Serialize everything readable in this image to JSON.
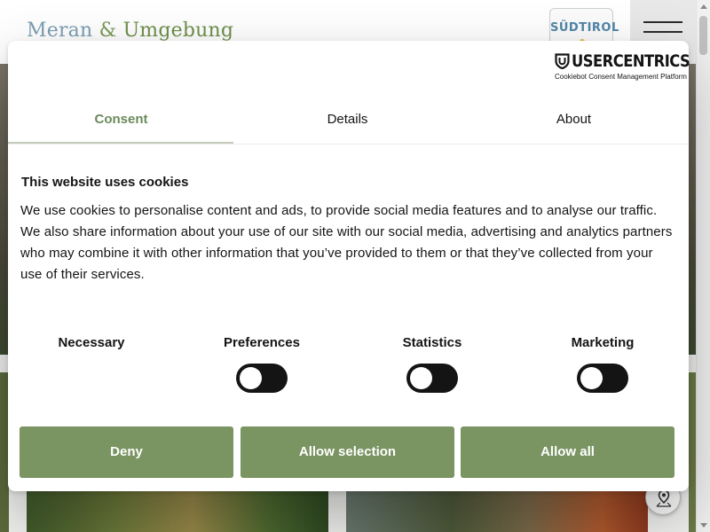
{
  "site": {
    "logo_part1": "Meran",
    "logo_amp": "&",
    "logo_part2": "Umgebung",
    "region_badge": "SÜDTIROL"
  },
  "consent": {
    "brand_name": "USERCENTRICS",
    "brand_sub": "Cookiebot Consent Management Platform",
    "tabs": [
      {
        "label": "Consent",
        "active": true
      },
      {
        "label": "Details",
        "active": false
      },
      {
        "label": "About",
        "active": false
      }
    ],
    "heading": "This website uses cookies",
    "body": "We use cookies to personalise content and ads, to provide social media features and to analyse our traffic. We also share information about your use of our site with our social media, advertising and analytics partners who may combine it with other information that you’ve provided to them or that they’ve collected from your use of their services.",
    "categories": [
      {
        "label": "Necessary",
        "has_toggle": false
      },
      {
        "label": "Preferences",
        "has_toggle": true,
        "checked": false
      },
      {
        "label": "Statistics",
        "has_toggle": true,
        "checked": false
      },
      {
        "label": "Marketing",
        "has_toggle": true,
        "checked": false
      }
    ],
    "buttons": {
      "deny": "Deny",
      "allow_selection": "Allow selection",
      "allow_all": "Allow all"
    }
  },
  "colors": {
    "accent_green": "#7a9462",
    "active_tab": "#6a8a5a",
    "toggle_off": "#141414"
  },
  "icons": {
    "menu": "hamburger-icon",
    "map_fab": "map-pin-icon",
    "brand": "usercentrics-shield-icon"
  }
}
